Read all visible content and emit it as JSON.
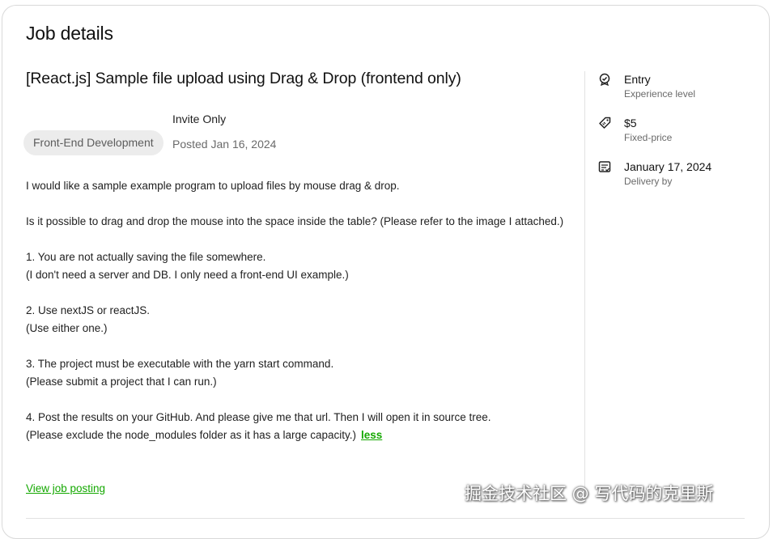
{
  "header": {
    "title": "Job details"
  },
  "job": {
    "title": "[React.js] Sample file upload using Drag & Drop (frontend only)",
    "category": "Front-End Development",
    "visibility": "Invite Only",
    "posted": "Posted Jan 16, 2024",
    "description": [
      "I would like a sample example program to upload files by mouse drag & drop.",
      "Is it possible to drag and drop the mouse into the space inside the table? (Please refer to the image I attached.)",
      "1. You are not actually saving the file somewhere.",
      "(I don't need a server and DB. I only need a front-end UI example.)",
      "2. Use nextJS or reactJS.",
      "(Use either one.)",
      "3. The project must be executable with the yarn start command.",
      "(Please submit a project that I can run.)",
      "4. Post the results on your GitHub. And please give me that url. Then I will open it in source tree.",
      "(Please exclude the node_modules folder as it has a large capacity.)"
    ],
    "less_label": "less",
    "view_posting_label": "View job posting"
  },
  "sidebar": {
    "items": [
      {
        "value": "Entry",
        "label": "Experience level",
        "icon": "experience-level-icon"
      },
      {
        "value": "$5",
        "label": "Fixed-price",
        "icon": "price-tag-icon"
      },
      {
        "value": "January 17, 2024",
        "label": "Delivery by",
        "icon": "delivery-calendar-icon"
      }
    ]
  },
  "watermark": "掘金技术社区 @ 写代码的克里斯",
  "colors": {
    "accent": "#14a800",
    "pill_bg": "#ececec",
    "border": "#d9d9d9"
  }
}
